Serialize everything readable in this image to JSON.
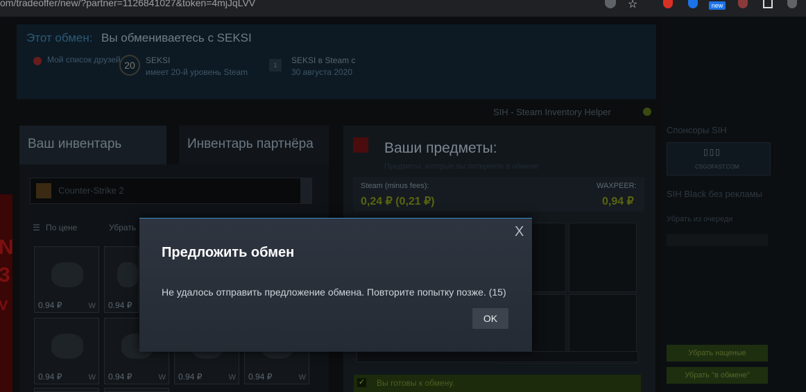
{
  "browser": {
    "url": "om/tradeoffer/new/?partner=1126841027&token=4mjJqLVV",
    "extension_badge": "new"
  },
  "header": {
    "label": "Этот обмен:",
    "title": "Вы обмениваетесь с SEKSI",
    "warning_text": "Мой список друзей",
    "partner_level": "20",
    "partner_name": "SEKSI",
    "partner_level_text": "имеет 20-й уровень Steam",
    "since_icon": "1",
    "since_title": "SEKSI в Steam с",
    "since_date": "30 августа 2020"
  },
  "sih": {
    "label": "SIH - Steam Inventory Helper"
  },
  "tabs": {
    "yours": "Ваш инвентарь",
    "partner": "Инвентарь партнёра"
  },
  "inventory": {
    "game": "Counter-Strike 2",
    "sort_label": "По цене",
    "remove_label": "Убрать",
    "items": [
      {
        "price": "0.94 ₽",
        "wear": "W"
      },
      {
        "price": "0.94 ₽",
        "wear": "W"
      },
      {
        "price": "0.94 ₽",
        "wear": "W"
      },
      {
        "price": "0.94 ₽",
        "wear": "W"
      },
      {
        "price": "0.94 ₽",
        "wear": "W"
      },
      {
        "price": "0.94 ₽",
        "wear": "W"
      }
    ]
  },
  "trade": {
    "title": "Ваши предметы:",
    "subtitle": "Предметы, которые вы потеряете в обмене",
    "steam_label": "Steam (minus fees):",
    "steam_value": "0,24 ₽ (0,21 ₽)",
    "wax_label": "WAXPEER:",
    "wax_value": "0,94 ₽",
    "ready_text": "Вы готовы к обмену."
  },
  "sidebar": {
    "sponsors": "Спонсоры SIH",
    "sponsor_logo": "CSGOFAST.COM",
    "sih_black": "SIH Black без рекламы",
    "remove_queue": "Убрать из очереди",
    "remove_cheap": "Убрать наценые",
    "remove_in_trade": "Убрать \"в обмене\""
  },
  "modal": {
    "title": "Предложить обмен",
    "message": "Не удалось отправить предложение обмена. Повторите попытку позже. (15)",
    "ok": "OK",
    "close_glyph": "X"
  },
  "colors": {
    "modal_bg": "#2e3540",
    "modal_border": "#3d8fc7",
    "ok_button": "#3d434d",
    "price_green": "#5a6410"
  }
}
